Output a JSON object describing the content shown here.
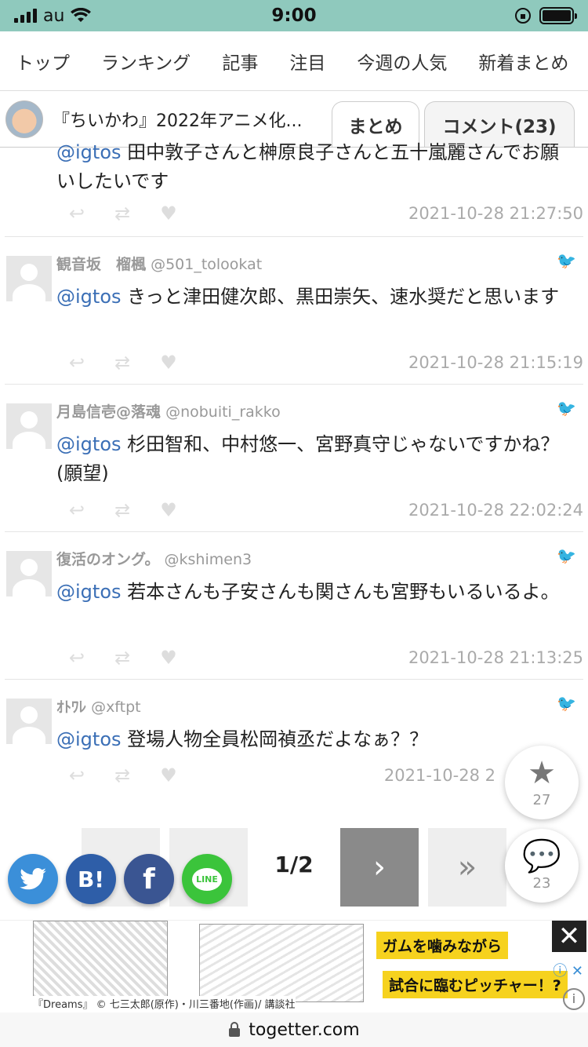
{
  "status": {
    "carrier": "au",
    "time": "9:00"
  },
  "nav": {
    "tabs": [
      "トップ",
      "ランキング",
      "記事",
      "注目",
      "今週の人気",
      "新着まとめ"
    ]
  },
  "subheader": {
    "title": "『ちいかわ』2022年アニメ化...",
    "tab_matome": "まとめ",
    "tab_comment": "コメント(23)"
  },
  "tweets": [
    {
      "mention": "@igtos",
      "text": "田中敦子さんと榊原良子さんと五十嵐麗さんでお願いしたいです",
      "date": "2021-10-28 21:27:50"
    },
    {
      "name": "観音坂　榴楓",
      "handle": "@501_tolookat",
      "mention": "@igtos",
      "text": "きっと津田健次郎、黒田崇矢、速水奨だと思います",
      "date": "2021-10-28 21:15:19"
    },
    {
      "name": "月島信壱@落魂",
      "handle": "@nobuiti_rakko",
      "mention": "@igtos",
      "text": "杉田智和、中村悠一、宮野真守じゃないですかね？(願望)",
      "date": "2021-10-28 22:02:24"
    },
    {
      "name": "復活のオング。",
      "handle": "@kshimen3",
      "mention": "@igtos",
      "text": "若本さんも子安さんも関さんも宮野もいるいるよ。",
      "date": "2021-10-28 21:13:25"
    },
    {
      "name": "ｵﾄﾜﾚ",
      "handle": "@xftpt",
      "mention": "@igtos",
      "text": "登場人物全員松岡禎丞だよなぁ？？",
      "date": "2021-10-28 2"
    }
  ],
  "pager": {
    "page": "1/2",
    "next": "›",
    "last": "»"
  },
  "fabs": {
    "favorites": "27",
    "comments": "23"
  },
  "share": {
    "hatena": "B!",
    "facebook": "f",
    "line": "LINE"
  },
  "ad": {
    "caption": "『Dreams』 © 七三太郎(原作)・川三番地(作画)/ 講談社",
    "line1": "ガムを噛みながら",
    "line2": "試合に臨むピッチャー！?"
  },
  "url": "togetter.com",
  "colors": {
    "status_bar": "#8fc9bd",
    "mention": "#3b6fb6",
    "twitter": "#3b8fd9",
    "hatena": "#2e5ea8",
    "facebook": "#3a5592",
    "line": "#3bc43b"
  }
}
